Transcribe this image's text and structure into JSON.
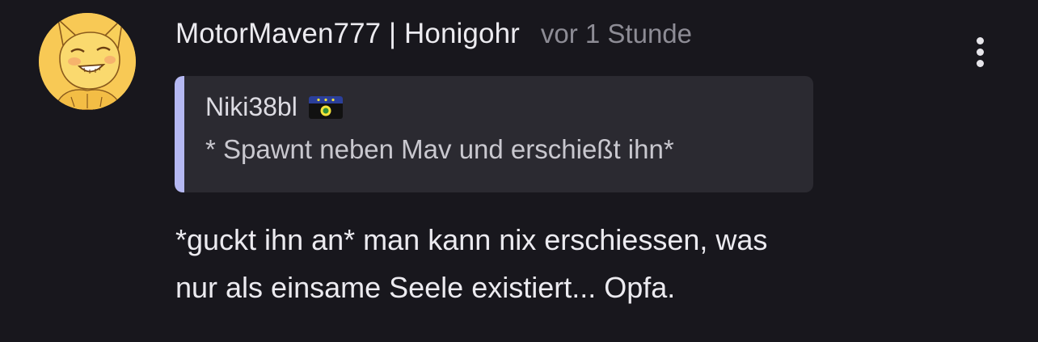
{
  "comment": {
    "username": "MotorMaven777 | Honigohr",
    "timestamp": "vor 1 Stunde",
    "avatar_icon": "fox-character-avatar",
    "more_icon": "vertical-ellipsis-icon",
    "quote": {
      "author": "Niki38bl",
      "flag_icon": "guadeloupe-flag-emoji",
      "text": "* Spawnt neben Mav und erschießt ihn*"
    },
    "message_lines": [
      "*guckt ihn an* man kann nix erschiessen, was",
      "nur als einsame Seele existiert... Opfa."
    ]
  },
  "colors": {
    "background": "#18171d",
    "quote_background": "#2b2a31",
    "quote_accent": "#b5b8f2",
    "timestamp": "#8d8c95",
    "text": "#ecebf0"
  }
}
